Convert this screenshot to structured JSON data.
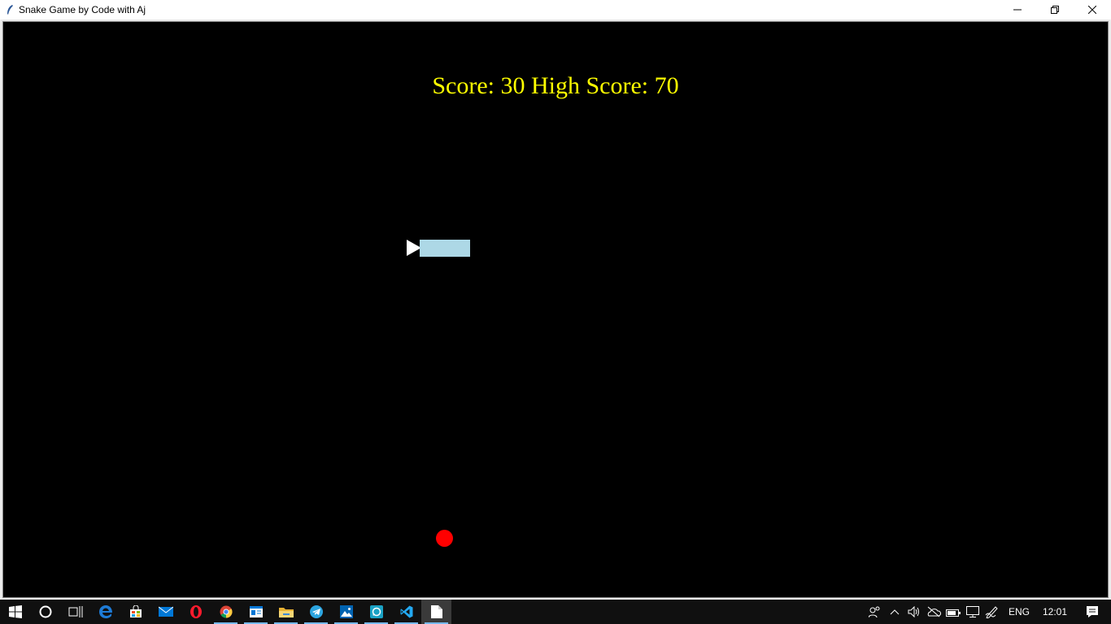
{
  "window": {
    "title": "Snake Game by Code with Aj",
    "icon": "feather-icon",
    "controls": [
      "minimize-icon",
      "restore-icon",
      "close-icon"
    ]
  },
  "game": {
    "score_text": "Score: 30 High Score: 70",
    "score": 30,
    "high_score": 70,
    "background_color": "#000000",
    "score_color": "#ffff00",
    "snake_head_color": "#ffffff",
    "snake_body_color": "#add8e6",
    "food_color": "#ff0000",
    "snake_direction": "left",
    "snake_segments": 4
  },
  "taskbar": {
    "items": [
      "windows-start-icon",
      "cortana-icon",
      "task-view-icon",
      "edge-icon",
      "store-icon",
      "mail-icon",
      "opera-icon",
      "chrome-icon",
      "news-icon",
      "file-explorer-icon",
      "telegram-icon",
      "photos-icon",
      "whatsapp-icon",
      "vscode-icon",
      "python-file-icon"
    ],
    "language": "ENG",
    "time": "12:01"
  }
}
